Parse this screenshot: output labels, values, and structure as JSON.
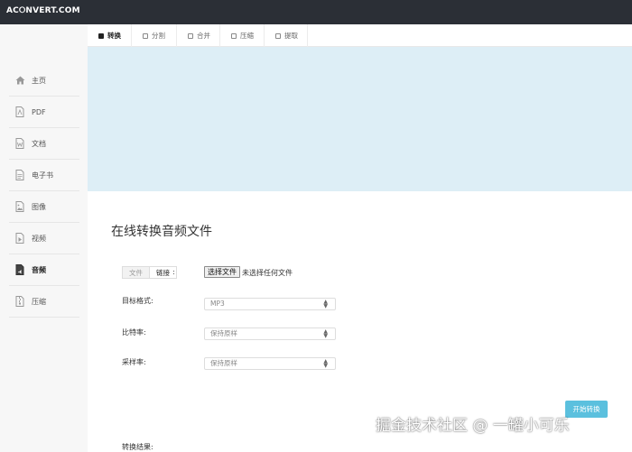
{
  "app": {
    "logo": "AC⭘NVERT.COM"
  },
  "tabs": [
    {
      "label": "转换",
      "active": true
    },
    {
      "label": "分割",
      "active": false
    },
    {
      "label": "合并",
      "active": false
    },
    {
      "label": "压缩",
      "active": false
    },
    {
      "label": "提取",
      "active": false
    }
  ],
  "sidebar": {
    "items": [
      {
        "label": "主页",
        "icon": "home-icon"
      },
      {
        "label": "PDF",
        "icon": "pdf-icon"
      },
      {
        "label": "文档",
        "icon": "document-icon"
      },
      {
        "label": "电子书",
        "icon": "ebook-icon"
      },
      {
        "label": "图像",
        "icon": "image-icon"
      },
      {
        "label": "视频",
        "icon": "video-icon"
      },
      {
        "label": "音频",
        "icon": "audio-icon",
        "active": true
      },
      {
        "label": "压缩",
        "icon": "archive-icon"
      }
    ]
  },
  "main": {
    "title": "在线转换音频文件",
    "source_toggle": {
      "file": "文件",
      "link": "链接",
      "colon": ":"
    },
    "file_input": {
      "button": "选择文件",
      "status": "未选择任何文件"
    },
    "fields": [
      {
        "label": "目标格式:",
        "value": "MP3"
      },
      {
        "label": "比特率:",
        "value": "保持原样"
      },
      {
        "label": "采样率:",
        "value": "保持原样"
      }
    ],
    "start_button": "开始转换",
    "result_label": "转换结果:"
  },
  "watermark": "掘金技术社区 @ 一罐小可乐",
  "colors": {
    "topbar": "#2b2f36",
    "banner": "#ddeef6",
    "sidebar": "#f7f7f7",
    "accent": "#5bc0de"
  }
}
